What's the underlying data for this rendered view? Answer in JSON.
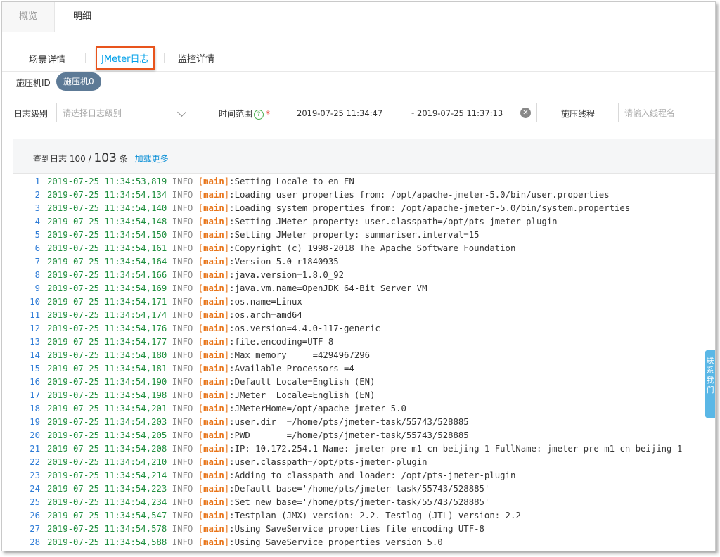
{
  "top_tabs": [
    {
      "label": "概览"
    },
    {
      "label": "明细"
    }
  ],
  "sub_tabs": [
    {
      "label": "场景详情"
    },
    {
      "label": "JMeter日志"
    },
    {
      "label": "监控详情"
    }
  ],
  "press_machine": {
    "label": "施压机ID",
    "value": "施压机0"
  },
  "filters": {
    "log_level": {
      "label": "日志级别",
      "placeholder": "请选择日志级别"
    },
    "time_range": {
      "label": "时间范围",
      "start": "2019-07-25 11:34:47",
      "separator": "-",
      "end": "2019-07-25 11:37:13"
    },
    "thread": {
      "label": "施压线程",
      "placeholder": "请输入线程名"
    }
  },
  "summary": {
    "prefix": "查到日志",
    "shown": "100",
    "slash": "/",
    "total": "103",
    "unit": "条",
    "load_more": "加载更多"
  },
  "log_lines": [
    {
      "n": "1",
      "ts": "2019-07-25 11:34:53,819",
      "lvl": "INFO",
      "thread": "main",
      "msg": "Setting Locale to en_EN"
    },
    {
      "n": "2",
      "ts": "2019-07-25 11:34:54,134",
      "lvl": "INFO",
      "thread": "main",
      "msg": "Loading user properties from: /opt/apache-jmeter-5.0/bin/user.properties"
    },
    {
      "n": "3",
      "ts": "2019-07-25 11:34:54,140",
      "lvl": "INFO",
      "thread": "main",
      "msg": "Loading system properties from: /opt/apache-jmeter-5.0/bin/system.properties"
    },
    {
      "n": "4",
      "ts": "2019-07-25 11:34:54,148",
      "lvl": "INFO",
      "thread": "main",
      "msg": "Setting JMeter property: user.classpath=/opt/pts-jmeter-plugin"
    },
    {
      "n": "5",
      "ts": "2019-07-25 11:34:54,150",
      "lvl": "INFO",
      "thread": "main",
      "msg": "Setting JMeter property: summariser.interval=15"
    },
    {
      "n": "6",
      "ts": "2019-07-25 11:34:54,161",
      "lvl": "INFO",
      "thread": "main",
      "msg": "Copyright (c) 1998-2018 The Apache Software Foundation"
    },
    {
      "n": "7",
      "ts": "2019-07-25 11:34:54,164",
      "lvl": "INFO",
      "thread": "main",
      "msg": "Version 5.0 r1840935"
    },
    {
      "n": "8",
      "ts": "2019-07-25 11:34:54,166",
      "lvl": "INFO",
      "thread": "main",
      "msg": "java.version=1.8.0_92"
    },
    {
      "n": "9",
      "ts": "2019-07-25 11:34:54,169",
      "lvl": "INFO",
      "thread": "main",
      "msg": "java.vm.name=OpenJDK 64-Bit Server VM"
    },
    {
      "n": "10",
      "ts": "2019-07-25 11:34:54,171",
      "lvl": "INFO",
      "thread": "main",
      "msg": "os.name=Linux"
    },
    {
      "n": "11",
      "ts": "2019-07-25 11:34:54,174",
      "lvl": "INFO",
      "thread": "main",
      "msg": "os.arch=amd64"
    },
    {
      "n": "12",
      "ts": "2019-07-25 11:34:54,176",
      "lvl": "INFO",
      "thread": "main",
      "msg": "os.version=4.4.0-117-generic"
    },
    {
      "n": "13",
      "ts": "2019-07-25 11:34:54,177",
      "lvl": "INFO",
      "thread": "main",
      "msg": "file.encoding=UTF-8"
    },
    {
      "n": "14",
      "ts": "2019-07-25 11:34:54,180",
      "lvl": "INFO",
      "thread": "main",
      "msg": "Max memory     =4294967296"
    },
    {
      "n": "15",
      "ts": "2019-07-25 11:34:54,181",
      "lvl": "INFO",
      "thread": "main",
      "msg": "Available Processors =4"
    },
    {
      "n": "16",
      "ts": "2019-07-25 11:34:54,190",
      "lvl": "INFO",
      "thread": "main",
      "msg": "Default Locale=English (EN)"
    },
    {
      "n": "17",
      "ts": "2019-07-25 11:34:54,198",
      "lvl": "INFO",
      "thread": "main",
      "msg": "JMeter  Locale=English (EN)"
    },
    {
      "n": "18",
      "ts": "2019-07-25 11:34:54,201",
      "lvl": "INFO",
      "thread": "main",
      "msg": "JMeterHome=/opt/apache-jmeter-5.0"
    },
    {
      "n": "19",
      "ts": "2019-07-25 11:34:54,203",
      "lvl": "INFO",
      "thread": "main",
      "msg": "user.dir  =/home/pts/jmeter-task/55743/528885"
    },
    {
      "n": "20",
      "ts": "2019-07-25 11:34:54,205",
      "lvl": "INFO",
      "thread": "main",
      "msg": "PWD       =/home/pts/jmeter-task/55743/528885"
    },
    {
      "n": "21",
      "ts": "2019-07-25 11:34:54,208",
      "lvl": "INFO",
      "thread": "main",
      "msg": "IP: 10.172.254.1 Name: jmeter-pre-m1-cn-beijing-1 FullName: jmeter-pre-m1-cn-beijing-1"
    },
    {
      "n": "22",
      "ts": "2019-07-25 11:34:54,210",
      "lvl": "INFO",
      "thread": "main",
      "msg": "user.classpath=/opt/pts-jmeter-plugin"
    },
    {
      "n": "23",
      "ts": "2019-07-25 11:34:54,214",
      "lvl": "INFO",
      "thread": "main",
      "msg": "Adding to classpath and loader: /opt/pts-jmeter-plugin"
    },
    {
      "n": "24",
      "ts": "2019-07-25 11:34:54,223",
      "lvl": "INFO",
      "thread": "main",
      "msg": "Default base='/home/pts/jmeter-task/55743/528885'"
    },
    {
      "n": "25",
      "ts": "2019-07-25 11:34:54,234",
      "lvl": "INFO",
      "thread": "main",
      "msg": "Set new base='/home/pts/jmeter-task/55743/528885'"
    },
    {
      "n": "26",
      "ts": "2019-07-25 11:34:54,547",
      "lvl": "INFO",
      "thread": "main",
      "msg": "Testplan (JMX) version: 2.2. Testlog (JTL) version: 2.2"
    },
    {
      "n": "27",
      "ts": "2019-07-25 11:34:54,578",
      "lvl": "INFO",
      "thread": "main",
      "msg": "Using SaveService properties file encoding UTF-8"
    },
    {
      "n": "28",
      "ts": "2019-07-25 11:34:54,588",
      "lvl": "INFO",
      "thread": "main",
      "msg": "Using SaveService properties version 5.0"
    }
  ],
  "side_tab": {
    "label": "联系我们"
  },
  "colors": {
    "accent": "#00a0e9",
    "highlight_border": "#e8541c",
    "pill": "#5d7a96",
    "timestamp": "#1e8e3e",
    "thread": "#e8751a",
    "line_number": "#2d7bd6"
  },
  "icons": {
    "help": "question-circle-icon",
    "clear": "close-circle-icon",
    "dropdown": "chevron-down-icon"
  }
}
